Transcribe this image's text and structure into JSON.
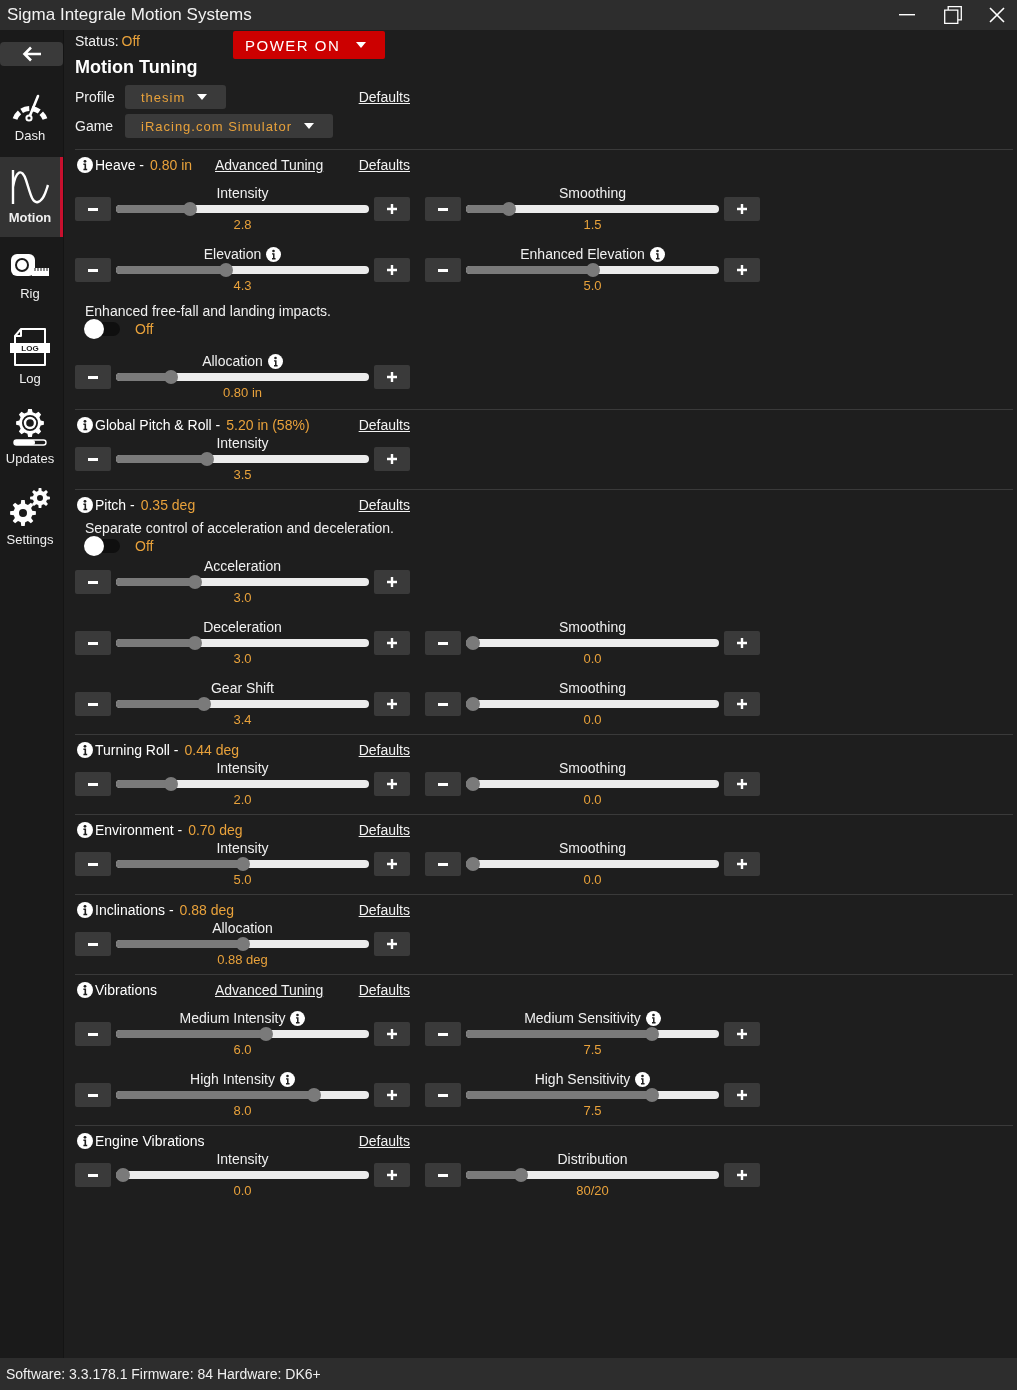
{
  "window": {
    "title": "Sigma Integrale Motion Systems"
  },
  "sidebar": {
    "items": [
      {
        "kind": "gauge",
        "label": "Dash",
        "selected": false
      },
      {
        "kind": "wave",
        "label": "Motion",
        "selected": true
      },
      {
        "kind": "tape",
        "label": "Rig",
        "selected": false
      },
      {
        "kind": "log",
        "label": "Log",
        "icon_text": "LOG",
        "selected": false
      },
      {
        "kind": "update",
        "label": "Updates",
        "selected": false
      },
      {
        "kind": "gears",
        "label": "Settings",
        "selected": false
      }
    ]
  },
  "header": {
    "status_label": "Status:",
    "status_value": "Off",
    "power_button": "POWER ON",
    "title": "Motion Tuning",
    "fields": [
      {
        "label": "Profile",
        "value": "thesim",
        "link": "Defaults"
      },
      {
        "label": "Game",
        "value": "iRacing.com Simulator"
      }
    ]
  },
  "sections": [
    {
      "title": "Heave -",
      "reading": "0.80 in",
      "info": true,
      "links": [
        "Advanced Tuning"
      ],
      "defaults": "Defaults",
      "rows": [
        {
          "kind": "sliders",
          "cells": [
            {
              "label": "Intensity",
              "info": false,
              "level": 0.28,
              "reading": "2.8"
            },
            {
              "label": "Smoothing",
              "info": false,
              "level": 0.15,
              "reading": "1.5"
            }
          ]
        },
        {
          "kind": "sliders",
          "cells": [
            {
              "label": "Elevation",
              "info": true,
              "level": 0.43,
              "reading": "4.3"
            },
            {
              "label": "Enhanced Elevation",
              "info": true,
              "level": 0.5,
              "reading": "5.0"
            }
          ]
        },
        {
          "kind": "toggle",
          "text": "Enhanced free-fall and landing impacts.",
          "on": false,
          "state": "Off"
        },
        {
          "kind": "sliders",
          "cells": [
            {
              "label": "Allocation",
              "info": true,
              "level": 0.2,
              "reading": "0.80 in"
            }
          ]
        }
      ]
    },
    {
      "title": "Global Pitch & Roll -",
      "reading": "5.20 in (58%)",
      "info": true,
      "defaults": "Defaults",
      "rows": [
        {
          "kind": "sliders",
          "cells": [
            {
              "label": "Intensity",
              "info": false,
              "level": 0.35,
              "reading": "3.5"
            }
          ]
        }
      ]
    },
    {
      "title": "Pitch -",
      "reading": "0.35 deg",
      "info": true,
      "defaults": "Defaults",
      "rows": [
        {
          "kind": "toggle",
          "text": "Separate control of acceleration and deceleration.",
          "on": false,
          "state": "Off"
        },
        {
          "kind": "sliders",
          "cells": [
            {
              "label": "Acceleration",
              "info": false,
              "level": 0.3,
              "reading": "3.0"
            }
          ]
        },
        {
          "kind": "sliders",
          "cells": [
            {
              "label": "Deceleration",
              "info": false,
              "level": 0.3,
              "reading": "3.0"
            },
            {
              "label": "Smoothing",
              "info": false,
              "level": 0,
              "reading": "0.0"
            }
          ]
        },
        {
          "kind": "sliders",
          "cells": [
            {
              "label": "Gear Shift",
              "info": false,
              "level": 0.34,
              "reading": "3.4"
            },
            {
              "label": "Smoothing",
              "info": false,
              "level": 0,
              "reading": "0.0"
            }
          ]
        }
      ]
    },
    {
      "title": "Turning Roll -",
      "reading": "0.44 deg",
      "info": true,
      "defaults": "Defaults",
      "rows": [
        {
          "kind": "sliders",
          "cells": [
            {
              "label": "Intensity",
              "info": false,
              "level": 0.2,
              "reading": "2.0"
            },
            {
              "label": "Smoothing",
              "info": false,
              "level": 0,
              "reading": "0.0"
            }
          ]
        }
      ]
    },
    {
      "title": "Environment -",
      "reading": "0.70 deg",
      "info": true,
      "defaults": "Defaults",
      "rows": [
        {
          "kind": "sliders",
          "cells": [
            {
              "label": "Intensity",
              "info": false,
              "level": 0.5,
              "reading": "5.0"
            },
            {
              "label": "Smoothing",
              "info": false,
              "level": 0,
              "reading": "0.0"
            }
          ]
        }
      ]
    },
    {
      "title": "Inclinations -",
      "reading": "0.88 deg",
      "info": true,
      "defaults": "Defaults",
      "rows": [
        {
          "kind": "sliders",
          "cells": [
            {
              "label": "Allocation",
              "info": false,
              "level": 0.5,
              "reading": "0.88 deg"
            }
          ]
        }
      ]
    },
    {
      "title": "Vibrations",
      "info": true,
      "links": [
        "Advanced Tuning"
      ],
      "defaults": "Defaults",
      "rows": [
        {
          "kind": "sliders",
          "cells": [
            {
              "label": "Medium Intensity",
              "info": true,
              "level": 0.6,
              "reading": "6.0"
            },
            {
              "label": "Medium Sensitivity",
              "info": true,
              "level": 0.75,
              "reading": "7.5"
            }
          ]
        },
        {
          "kind": "sliders",
          "cells": [
            {
              "label": "High Intensity",
              "info": true,
              "level": 0.8,
              "reading": "8.0"
            },
            {
              "label": "High Sensitivity",
              "info": true,
              "level": 0.75,
              "reading": "7.5"
            }
          ]
        }
      ]
    },
    {
      "title": "Engine Vibrations",
      "info": true,
      "defaults": "Defaults",
      "rows": [
        {
          "kind": "sliders",
          "cells": [
            {
              "label": "Intensity",
              "info": false,
              "level": 0,
              "reading": "0.0"
            },
            {
              "label": "Distribution",
              "info": false,
              "level": 0.2,
              "reading": "80/20"
            }
          ]
        }
      ]
    }
  ],
  "status_bar": {
    "text": "Software: 3.3.178.1 Firmware: 84 Hardware: DK6+"
  }
}
